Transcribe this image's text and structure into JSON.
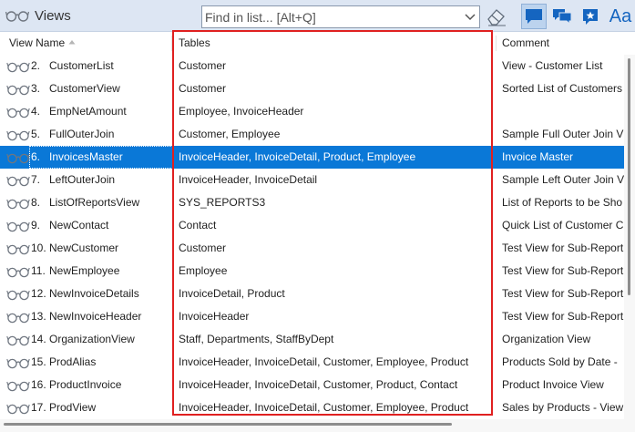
{
  "toolbar": {
    "title": "Views",
    "search_placeholder": "Find in list... [Alt+Q]",
    "font_button_label": "Aa",
    "icons": [
      "glasses-icon",
      "chevron-down-icon",
      "eraser-icon",
      "comment-icon",
      "comments-icon",
      "star-icon",
      "font-icon"
    ]
  },
  "columns": {
    "name": "View Name",
    "tables": "Tables",
    "comment": "Comment"
  },
  "colors": {
    "selection": "#0a78d7",
    "highlight_box": "#e02020",
    "toolbar_bg": "#dde6f3"
  },
  "rows": [
    {
      "num": "2.",
      "name": "CustomerList",
      "tables": "Customer",
      "comment": "View - Customer List"
    },
    {
      "num": "3.",
      "name": "CustomerView",
      "tables": "Customer",
      "comment": "Sorted List of Customers"
    },
    {
      "num": "4.",
      "name": "EmpNetAmount",
      "tables": "Employee, InvoiceHeader",
      "comment": ""
    },
    {
      "num": "5.",
      "name": "FullOuterJoin",
      "tables": "Customer, Employee",
      "comment": "Sample Full Outer Join V"
    },
    {
      "num": "6.",
      "name": "InvoicesMaster",
      "tables": "InvoiceHeader, InvoiceDetail, Product, Employee",
      "comment": "Invoice Master",
      "selected": true
    },
    {
      "num": "7.",
      "name": "LeftOuterJoin",
      "tables": "InvoiceHeader, InvoiceDetail",
      "comment": "Sample Left Outer Join V"
    },
    {
      "num": "8.",
      "name": "ListOfReportsView",
      "tables": "SYS_REPORTS3",
      "comment": "List of Reports to be Sho"
    },
    {
      "num": "9.",
      "name": "NewContact",
      "tables": "Contact",
      "comment": "Quick List of Customer C"
    },
    {
      "num": "10.",
      "name": "NewCustomer",
      "tables": "Customer",
      "comment": "Test View for Sub-Report"
    },
    {
      "num": "11.",
      "name": "NewEmployee",
      "tables": "Employee",
      "comment": "Test View for Sub-Report"
    },
    {
      "num": "12.",
      "name": "NewInvoiceDetails",
      "tables": "InvoiceDetail, Product",
      "comment": "Test View for Sub-Report"
    },
    {
      "num": "13.",
      "name": "NewInvoiceHeader",
      "tables": "InvoiceHeader",
      "comment": "Test View for Sub-Report"
    },
    {
      "num": "14.",
      "name": "OrganizationView",
      "tables": "Staff, Departments, StaffByDept",
      "comment": "Organization View"
    },
    {
      "num": "15.",
      "name": "ProdAlias",
      "tables": "InvoiceHeader, InvoiceDetail, Customer, Employee, Product",
      "comment": "Products Sold by Date - "
    },
    {
      "num": "16.",
      "name": "ProductInvoice",
      "tables": "InvoiceHeader, InvoiceDetail, Customer, Product, Contact",
      "comment": "Product Invoice View"
    },
    {
      "num": "17.",
      "name": "ProdView",
      "tables": "InvoiceHeader, InvoiceDetail, Customer, Employee, Product",
      "comment": "Sales by Products - View"
    }
  ]
}
